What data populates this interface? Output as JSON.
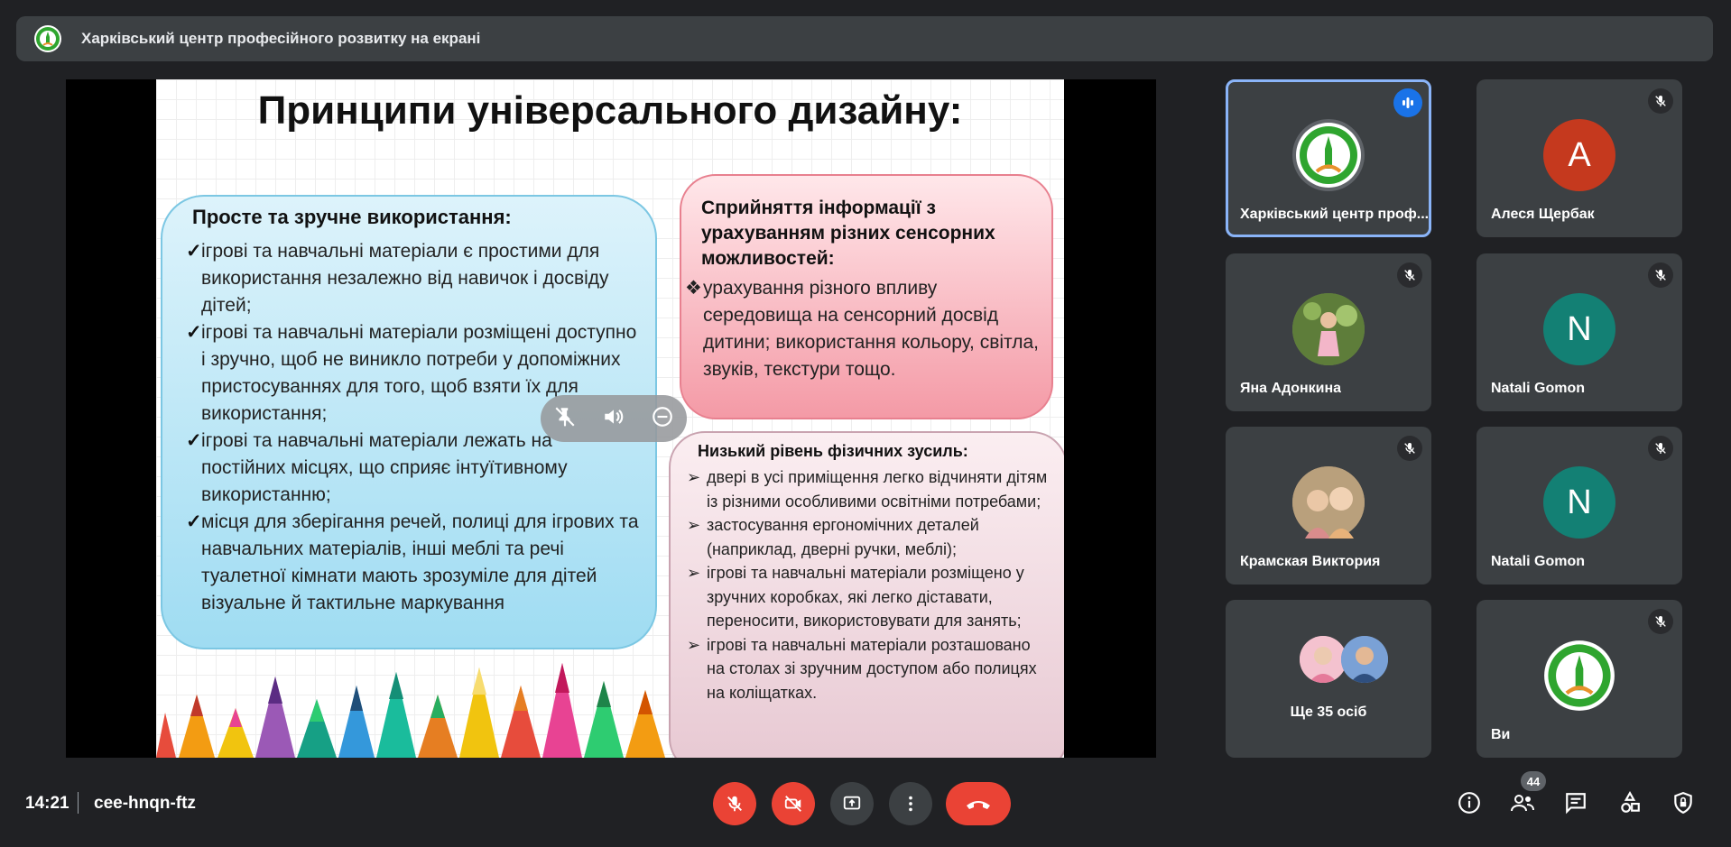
{
  "presenter_banner": {
    "title": "Харківський центр професійного розвитку на екрані",
    "icon": "org-logo-icon"
  },
  "slide": {
    "title": "Принципи універсального дизайну:",
    "blue_box": {
      "heading": "Просте та зручне використання:",
      "marker": "✓",
      "items": [
        "ігрові та навчальні матеріали є простими для використання незалежно від навичок і досвіду дітей;",
        "ігрові та навчальні матеріали розміщені доступно і зручно, щоб не виникло потреби у допоміжних пристосуваннях для того, щоб взяти їх для використання;",
        "ігрові та навчальні матеріали лежать на постійних місцях, що сприяє інтуїтивному використанню;",
        "місця для зберігання речей, полиці для ігрових та навчальних матеріалів, інші меблі та речі туалетної кімнати мають зрозуміле для дітей візуальне й тактильне маркування"
      ]
    },
    "red_box": {
      "heading": "Сприйняття інформації з урахуванням різних сенсорних можливостей:",
      "marker": "❖",
      "text": "урахування різного впливу середовища на сенсорний досвід дитини; використання кольору, світла, звуків, текстури тощо."
    },
    "pink_box": {
      "heading": "Низький рівень фізичних зусиль:",
      "marker": "➢",
      "items": [
        "двері в усі приміщення легко відчиняти дітям із різними особливими освітніми потребами;",
        "застосування ергономічних деталей (наприклад, дверні ручки, меблі);",
        "ігрові та навчальні матеріали розміщено у зручних коробках, які легко діставати, переносити, використовувати для занять;",
        "ігрові та навчальні матеріали розташовано на столах зі зручним доступом або полицях на коліщатках."
      ]
    }
  },
  "overlay_controls": [
    "unpin-icon",
    "volume-icon",
    "remove-icon"
  ],
  "participants": [
    {
      "name": "Харківський центр проф...",
      "avatar_type": "logo",
      "speaking": true
    },
    {
      "name": "Алеся Щербак",
      "avatar_type": "letter",
      "letter": "А",
      "color": "#c5391e",
      "muted": true
    },
    {
      "name": "Яна Адонкина",
      "avatar_type": "photo",
      "muted": true
    },
    {
      "name": "Natali Gomon",
      "avatar_type": "letter",
      "letter": "N",
      "color": "#138074",
      "muted": true
    },
    {
      "name": "Крамская Виктория",
      "avatar_type": "photo",
      "muted": true
    },
    {
      "name": "Natali Gomon",
      "avatar_type": "letter",
      "letter": "N",
      "color": "#138074",
      "muted": true
    },
    {
      "name": "Ще 35 осіб",
      "avatar_type": "group"
    },
    {
      "name": "Ви",
      "avatar_type": "logo",
      "muted": true
    }
  ],
  "bottom_bar": {
    "time": "14:21",
    "meeting_code": "cee-hnqn-ftz",
    "participants_count": "44",
    "controls": [
      "mic-off-button",
      "camera-off-button",
      "present-button",
      "more-options-button",
      "leave-call-button"
    ],
    "right_icons": [
      "info-icon",
      "people-icon",
      "chat-icon",
      "activities-icon",
      "host-controls-icon"
    ]
  },
  "colors": {
    "background": "#202124",
    "tile": "#3c4043",
    "danger": "#ea4335",
    "accent": "#8ab4f8"
  }
}
